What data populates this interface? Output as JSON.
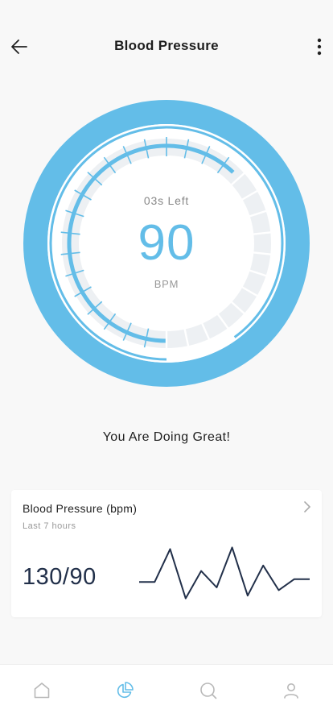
{
  "header": {
    "title": "Blood Pressure",
    "back_icon": "arrow-left-icon",
    "more_icon": "more-vertical-icon"
  },
  "gauge": {
    "time_left": "03s Left",
    "value": "90",
    "unit": "BPM",
    "progress": 0.9,
    "accent_color": "#63bde8",
    "track_color": "#edf0f3"
  },
  "status_text": "You Are Doing Great!",
  "card": {
    "title": "Blood Pressure (bpm)",
    "subtitle": "Last 7 hours",
    "value": "130/90",
    "chevron_icon": "chevron-right-icon",
    "chart_data": {
      "type": "line",
      "series": [
        {
          "values": [
            0.35,
            0.35,
            0.95,
            0.05,
            0.55,
            0.25,
            0.98,
            0.1,
            0.65,
            0.2,
            0.4,
            0.4
          ]
        }
      ]
    }
  },
  "tabs": [
    {
      "icon": "home-icon",
      "active": false
    },
    {
      "icon": "pie-chart-icon",
      "active": true
    },
    {
      "icon": "search-icon",
      "active": false
    },
    {
      "icon": "user-icon",
      "active": false
    }
  ],
  "colors": {
    "active_tab": "#63bde8",
    "inactive_tab": "#b8b8b8",
    "sparkline": "#22304a"
  }
}
